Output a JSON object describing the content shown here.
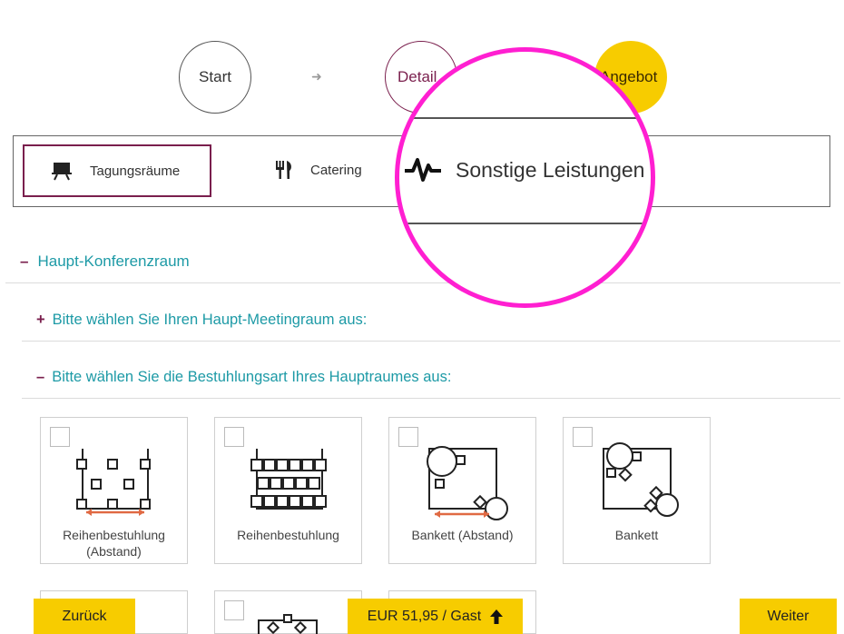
{
  "stepper": {
    "steps": [
      "Start",
      "Detail",
      "Angebot"
    ],
    "arrow": "➜"
  },
  "tabs": {
    "rooms": {
      "label": "Tagungsräume",
      "icon": "presentation-board-icon"
    },
    "catering": {
      "label": "Catering",
      "icon": "fork-knife-icon"
    },
    "other": {
      "label": "Sonstige Leistungen",
      "icon": "pulse-icon"
    }
  },
  "accordion": {
    "main": {
      "sign": "–",
      "label": "Haupt-Konferenzraum"
    },
    "meeting_room": {
      "sign": "+",
      "label": "Bitte wählen Sie Ihren Haupt-Meetingraum aus:"
    },
    "seating": {
      "sign": "–",
      "label": "Bitte wählen Sie die Bestuhlungsart Ihres Hauptraumes aus:"
    }
  },
  "seating_options": [
    {
      "label": "Reihenbestuhlung (Abstand)",
      "icon": "rows-spaced-icon"
    },
    {
      "label": "Reihenbestuhlung",
      "icon": "rows-icon"
    },
    {
      "label": "Bankett (Abstand)",
      "icon": "banquet-spaced-icon"
    },
    {
      "label": "Bankett",
      "icon": "banquet-icon"
    }
  ],
  "footer": {
    "back": "Zurück",
    "price": "EUR 51,95 / Gast",
    "next": "Weiter"
  },
  "colors": {
    "accent": "#7a1f4d",
    "link": "#1d9aa6",
    "button": "#f7cc00",
    "magnifier": "#ff1fd1"
  }
}
